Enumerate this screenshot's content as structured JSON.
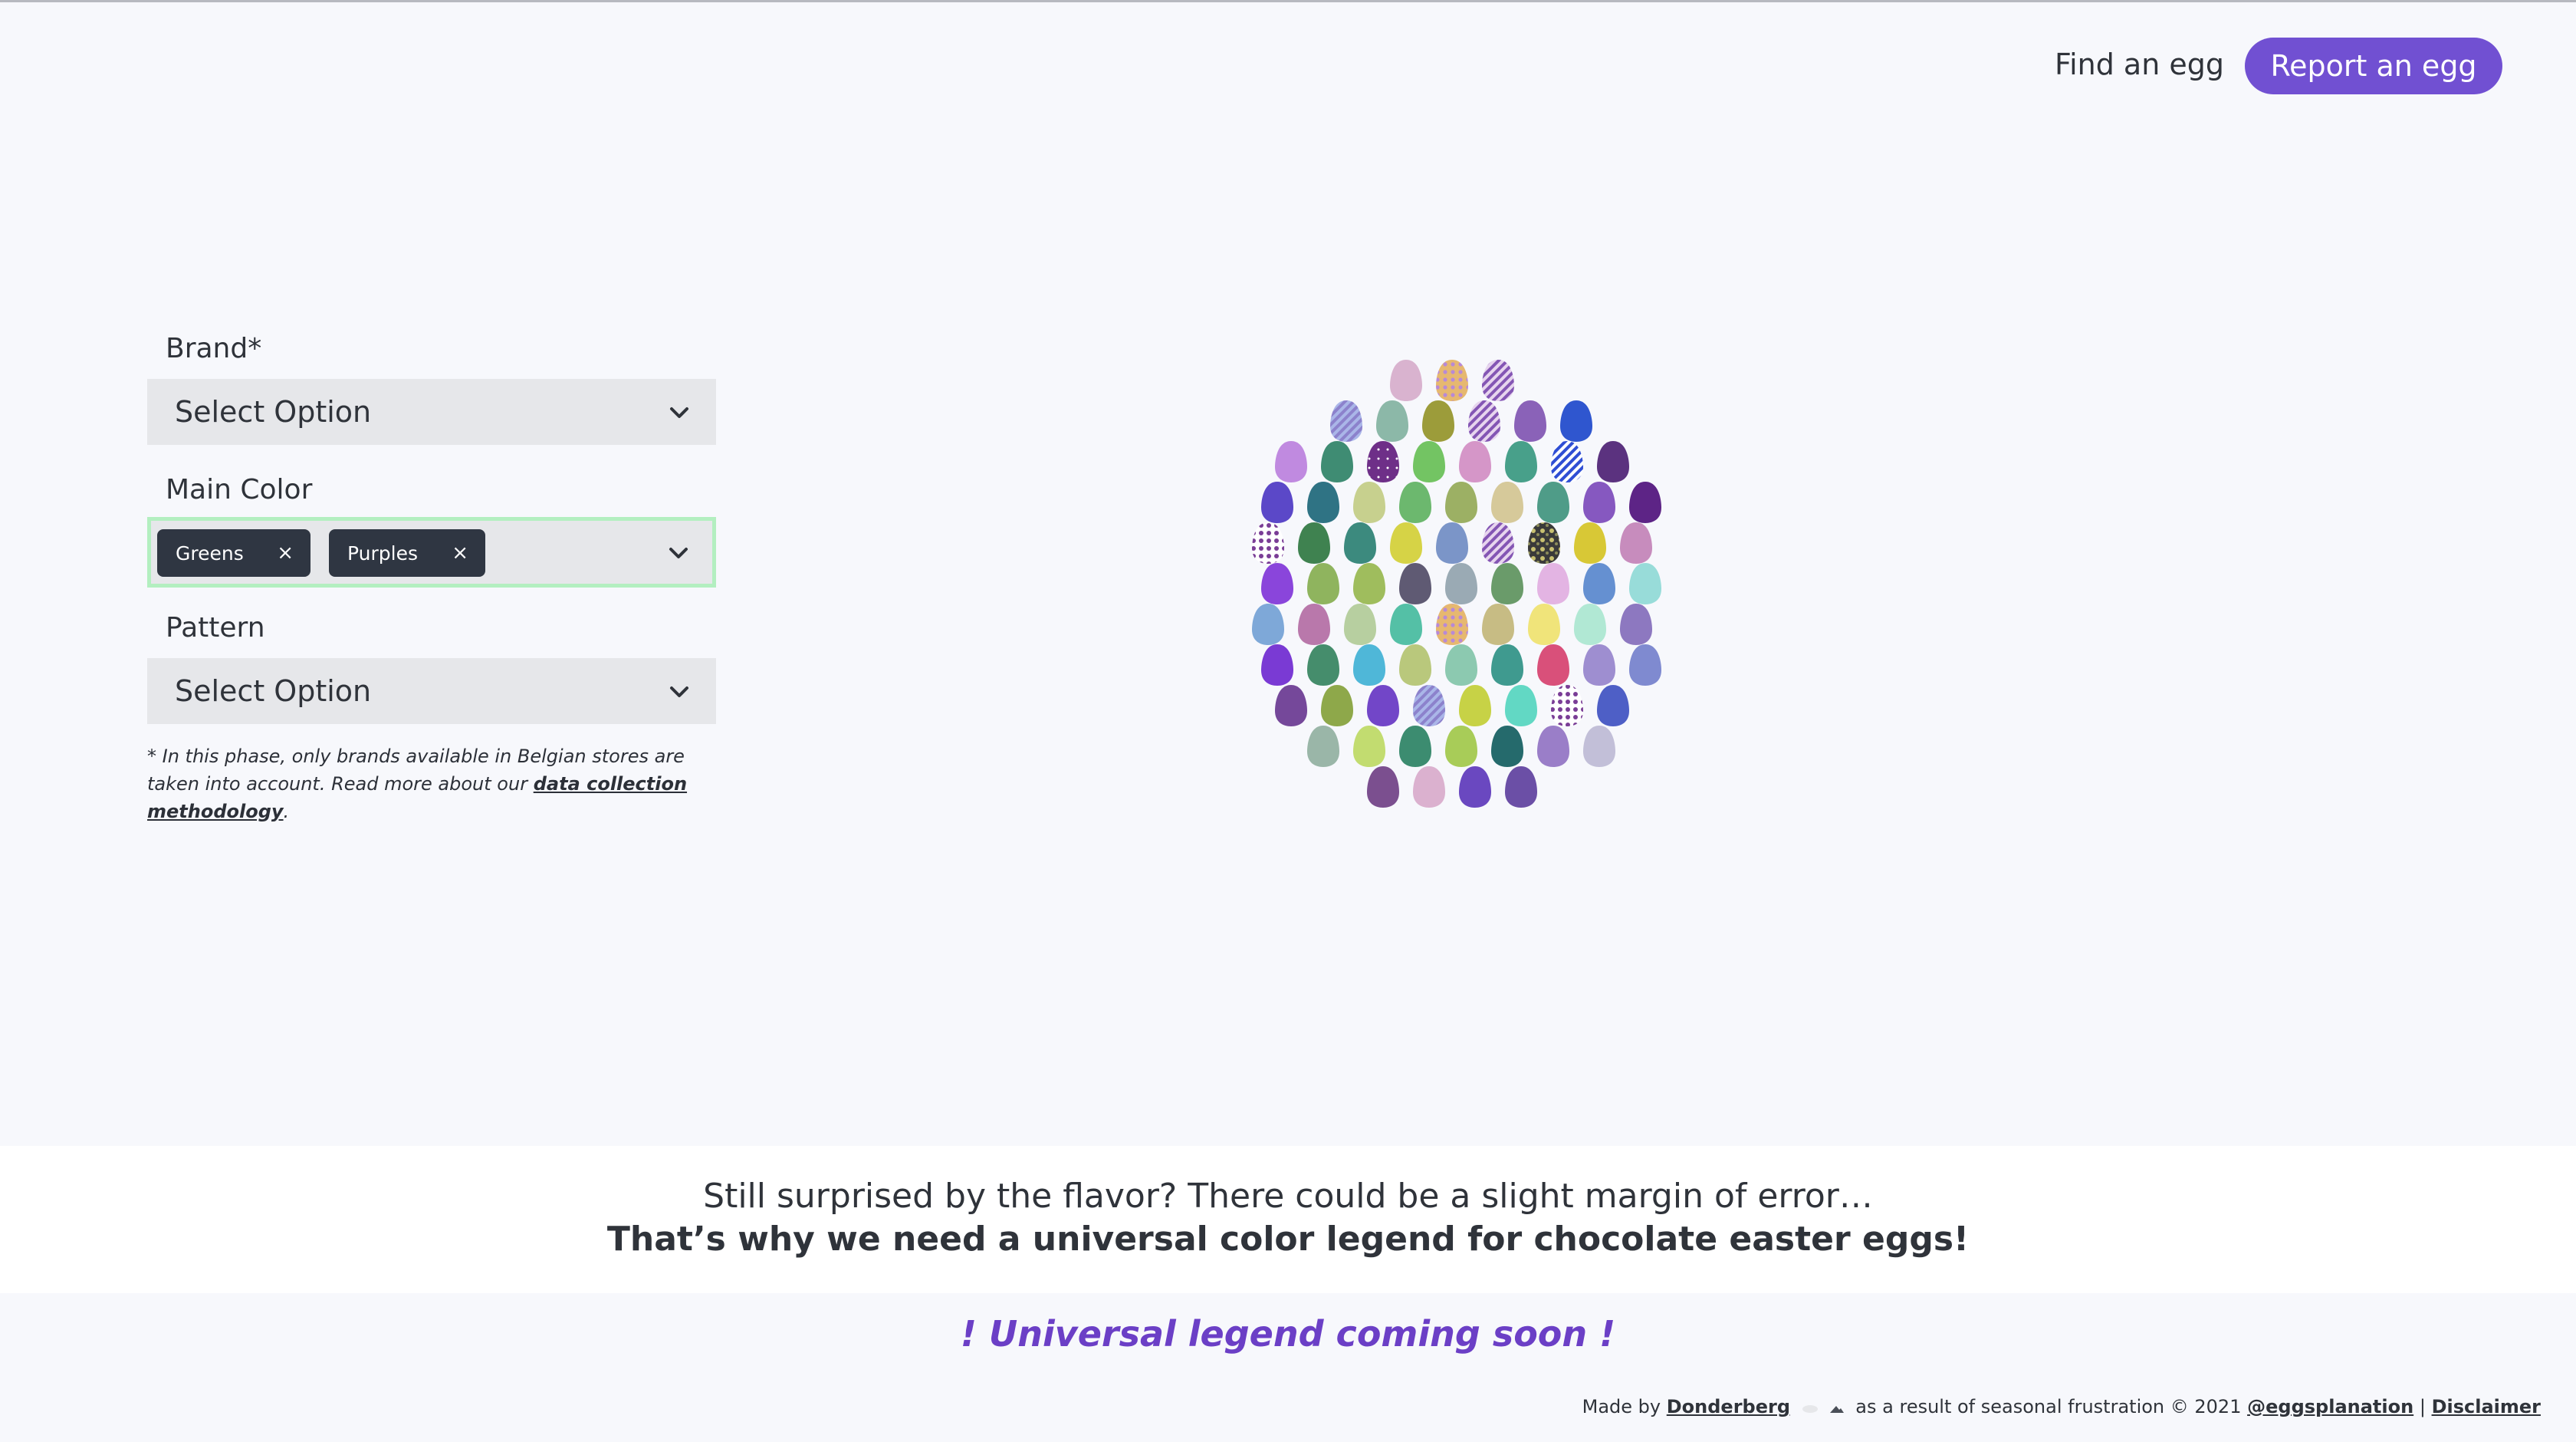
{
  "nav": {
    "find_label": "Find an egg",
    "report_label": "Report an egg"
  },
  "filters": {
    "brand": {
      "label": "Brand*",
      "placeholder": "Select Option"
    },
    "main_color": {
      "label": "Main Color",
      "chips": [
        "Greens",
        "Purples"
      ],
      "remove_glyph": "×"
    },
    "pattern": {
      "label": "Pattern",
      "placeholder": "Select Option"
    },
    "note": {
      "text_before": "* In this phase, only brands available in Belgian stores are taken into account. Read more about our ",
      "link": "data collection methodology",
      "text_after": "."
    }
  },
  "band": {
    "line1": "Still surprised by the flavor? There could be a slight margin of error…",
    "line2": "That’s why we need a universal color legend for chocolate easter eggs!"
  },
  "coming_soon": "! Universal legend coming soon !",
  "footer": {
    "made_by": "Made by",
    "author": "Donderberg",
    "middle": "as a result of seasonal frustration © 2021",
    "handle": "@eggsplanation",
    "sep": "|",
    "disclaimer": "Disclaimer"
  },
  "colors": {
    "accent": "#7150d2",
    "chip_bg": "#2f3642",
    "focus_border": "#b3efc0",
    "coming_soon": "#6b3fc6"
  },
  "eggs": {
    "rows": [
      [
        "#d9b3cf",
        "#d8b560:p1",
        "#9b6ab8:p2"
      ],
      [
        "#8f97d6:p3",
        "#8cb8a8",
        "#9c9c3a",
        "#9aa03e:p2",
        "#8a62b8",
        "#2f56cf"
      ],
      [
        "#c08ae0",
        "#3f8c73",
        "#6d2f87:p4",
        "#73c463",
        "#d596c8",
        "#48a08a",
        "#2d4bd8:p5",
        "#5b327f"
      ],
      [
        "#5b48c8",
        "#2f7384",
        "#c7d08e",
        "#6cb86e",
        "#9cb064",
        "#d6c99a",
        "#4f9c88",
        "#8658c0",
        "#5d2486"
      ],
      [
        "#7a3d96:p6",
        "#3f8250",
        "#3c8a7e",
        "#d6d346",
        "#7b95c8",
        "#d3de8c:p2",
        "#3a3a3a:p7",
        "#d8c836",
        "#c78cbd"
      ],
      [
        "#8a45db",
        "#8fb45e",
        "#9fbd5d",
        "#5f5a73",
        "#9aaab4",
        "#6a9b6a",
        "#e3b4e3",
        "#6590d1",
        "#98dcd9"
      ],
      [
        "#7ea8d8",
        "#b978ab",
        "#b7cfa0",
        "#54c0a6",
        "#a98ac5:p1",
        "#c7bc84",
        "#f0e47a",
        "#b1e8d4",
        "#8d78c0"
      ],
      [
        "#7a3ad4",
        "#458d6c",
        "#4fb7d8",
        "#b9c87c",
        "#8cc9b0",
        "#3f9a8f",
        "#d9507a",
        "#9e8ed0",
        "#7f8ad0"
      ],
      [
        "#75489a",
        "#8ea84a",
        "#7246c8",
        "#8c7cc6:p3",
        "#c7d246",
        "#62d8c4",
        "#e05a6a:p6",
        "#4e5fc6"
      ],
      [
        "#9ab6a8",
        "#c2dc70",
        "#3c8c70",
        "#a8cc58",
        "#256a6c",
        "#9a7ec8",
        "#c2bfd8"
      ],
      [
        "#7b4f8f",
        "#dbb1cf",
        "#6a48c0",
        "#6b4fa6"
      ]
    ]
  }
}
